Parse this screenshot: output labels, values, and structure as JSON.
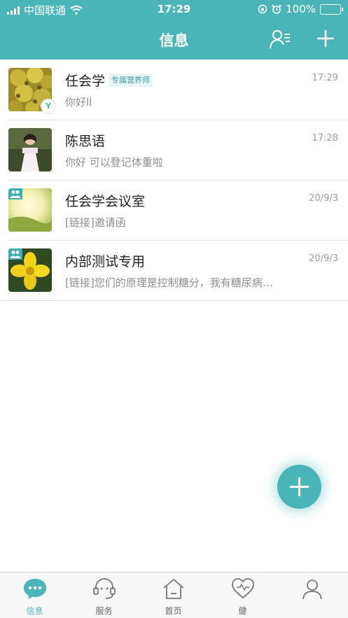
{
  "status_bar": {
    "carrier": "中国联通",
    "time": "17:29",
    "battery": "100%",
    "battery_level": 1.0,
    "icons": [
      "signal-icon",
      "wifi-icon",
      "rotation-lock-icon",
      "alarm-icon",
      "battery-charging-icon"
    ]
  },
  "header": {
    "title": "信息",
    "contacts_icon": "contacts-icon",
    "add_icon": "plus-icon"
  },
  "conversations": [
    {
      "name": "任会学",
      "tag": "专属营养师",
      "preview": "你好ll",
      "time": "17:29",
      "badge": "Y",
      "avatar": "durian-photo"
    },
    {
      "name": "陈思语",
      "tag": "",
      "preview": "你好 可以登记体重啦",
      "time": "17:28",
      "badge": "",
      "avatar": "girl-photo"
    },
    {
      "name": "任会学会议室",
      "tag": "",
      "preview": "[链接]邀请函",
      "time": "20/9/3",
      "badge": "",
      "avatar": "group-sunset-photo"
    },
    {
      "name": "内部测试专用",
      "tag": "",
      "preview": "[链接]您们的原理是控制糖分，我有糖尿病…",
      "time": "20/9/3",
      "badge": "",
      "avatar": "group-flower-photo"
    }
  ],
  "fab": {
    "icon": "plus-icon"
  },
  "tabs": [
    {
      "label": "信息",
      "icon": "chat-bubble-icon",
      "active": true
    },
    {
      "label": "服务",
      "icon": "headset-icon",
      "active": false
    },
    {
      "label": "首页",
      "icon": "home-icon",
      "active": false
    },
    {
      "label": "健",
      "icon": "heart-icon",
      "active": false
    },
    {
      "label": "",
      "icon": "profile-icon",
      "active": false
    }
  ],
  "colors": {
    "accent": "#4ab5b8",
    "battery_fill": "#63d46a"
  }
}
